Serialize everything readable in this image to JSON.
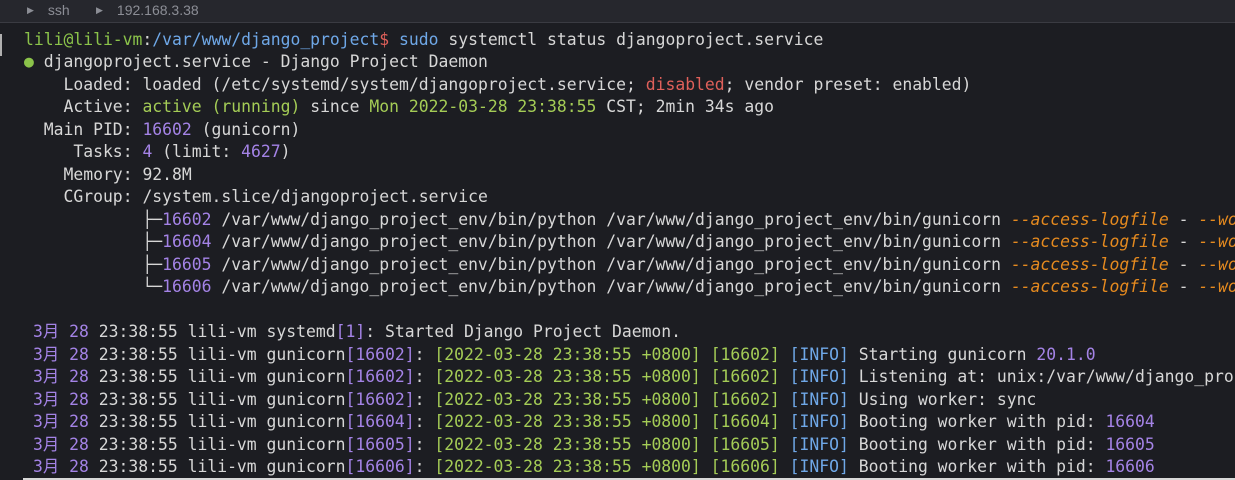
{
  "topbar": {
    "crumbs": [
      "ssh",
      "192.168.3.38"
    ]
  },
  "prompt": {
    "user": "lili@lili-vm",
    "sep": ":",
    "path": "/var/www/django_project",
    "dollar": "$",
    "cmd_sudo": "sudo",
    "cmd_rest": " systemctl status djangoproject.service"
  },
  "service": {
    "dot": "●",
    "name": "djangoproject.service",
    "desc": " - Django Project Daemon"
  },
  "loaded": {
    "label": "    Loaded",
    "colon": ": ",
    "value": "loaded",
    "paren_open": " (/etc/systemd/system/djangoproject.service; ",
    "disabled": "disabled",
    "semi": "; vendor preset",
    "colon2": ": ",
    "preset": "enabled",
    "close": ")"
  },
  "active": {
    "label": "    Active",
    "colon": ": ",
    "state": "active (running)",
    "since": " since ",
    "date": "Mon 2022-03-28 23:38:55",
    "tail": " CST; 2min 34s ago"
  },
  "mainpid": {
    "label": "  Main PID",
    "colon": ": ",
    "pid": "16602",
    "name": " (gunicorn)"
  },
  "tasks": {
    "label": "     Tasks",
    "colon": ": ",
    "count": "4",
    "lim_open": " (limit",
    "colon2": ": ",
    "limit": "4627",
    "close": ")"
  },
  "memory": {
    "label": "    Memory",
    "colon": ": ",
    "value": "92.8M"
  },
  "cgroup": {
    "label": "    CGroup",
    "colon": ": ",
    "value": "/system.slice/djangoproject.service",
    "procs": [
      {
        "tree": "            ├─",
        "pid": "16602",
        "cmd": " /var/www/django_project_env/bin/python /var/www/django_project_env/bin/gunicorn ",
        "opt": "--access-logfile",
        "dash": " - ",
        "opt2": "--work"
      },
      {
        "tree": "            ├─",
        "pid": "16604",
        "cmd": " /var/www/django_project_env/bin/python /var/www/django_project_env/bin/gunicorn ",
        "opt": "--access-logfile",
        "dash": " - ",
        "opt2": "--work"
      },
      {
        "tree": "            ├─",
        "pid": "16605",
        "cmd": " /var/www/django_project_env/bin/python /var/www/django_project_env/bin/gunicorn ",
        "opt": "--access-logfile",
        "dash": " - ",
        "opt2": "--work"
      },
      {
        "tree": "            └─",
        "pid": "16606",
        "cmd": " /var/www/django_project_env/bin/python /var/www/django_project_env/bin/gunicorn ",
        "opt": "--access-logfile",
        "dash": " - ",
        "opt2": "--work"
      }
    ]
  },
  "logs": {
    "first": {
      "month": "3月",
      "day": "28",
      "time": "23:38:55",
      "host": "lili-vm",
      "proc": "systemd",
      "pid": "1",
      "msg": "Started Django Project Daemon."
    },
    "entries": [
      {
        "month": "3月",
        "day": "28",
        "time": "23:38:55",
        "host": "lili-vm",
        "proc": "gunicorn",
        "pid": "16602",
        "stamp": "[2022-03-28 23:38:55 +0800]",
        "wpid": "16602",
        "level": "INFO",
        "msg_a": "Starting gunicorn ",
        "msg_b": "20.1.0"
      },
      {
        "month": "3月",
        "day": "28",
        "time": "23:38:55",
        "host": "lili-vm",
        "proc": "gunicorn",
        "pid": "16602",
        "stamp": "[2022-03-28 23:38:55 +0800]",
        "wpid": "16602",
        "level": "INFO",
        "msg_a": "Listening at",
        "msg_b": ": unix:/var/www/django_proje"
      },
      {
        "month": "3月",
        "day": "28",
        "time": "23:38:55",
        "host": "lili-vm",
        "proc": "gunicorn",
        "pid": "16602",
        "stamp": "[2022-03-28 23:38:55 +0800]",
        "wpid": "16602",
        "level": "INFO",
        "msg_a": "Using worker",
        "msg_b": ": sync"
      },
      {
        "month": "3月",
        "day": "28",
        "time": "23:38:55",
        "host": "lili-vm",
        "proc": "gunicorn",
        "pid": "16604",
        "stamp": "[2022-03-28 23:38:55 +0800]",
        "wpid": "16604",
        "level": "INFO",
        "msg_a": "Booting worker with pid: ",
        "msg_b": "16604"
      },
      {
        "month": "3月",
        "day": "28",
        "time": "23:38:55",
        "host": "lili-vm",
        "proc": "gunicorn",
        "pid": "16605",
        "stamp": "[2022-03-28 23:38:55 +0800]",
        "wpid": "16605",
        "level": "INFO",
        "msg_a": "Booting worker with pid: ",
        "msg_b": "16605"
      },
      {
        "month": "3月",
        "day": "28",
        "time": "23:38:55",
        "host": "lili-vm",
        "proc": "gunicorn",
        "pid": "16606",
        "stamp": "[2022-03-28 23:38:55 +0800]",
        "wpid": "16606",
        "level": "INFO",
        "msg_a": "Booting worker with pid: ",
        "msg_b": "16606"
      }
    ]
  },
  "colors": {
    "background": "#1c1d22",
    "green": "#8bc34a",
    "blue": "#6fa8e8",
    "purple": "#a483e6",
    "red": "#e0605a",
    "orange": "#e58a1f"
  }
}
